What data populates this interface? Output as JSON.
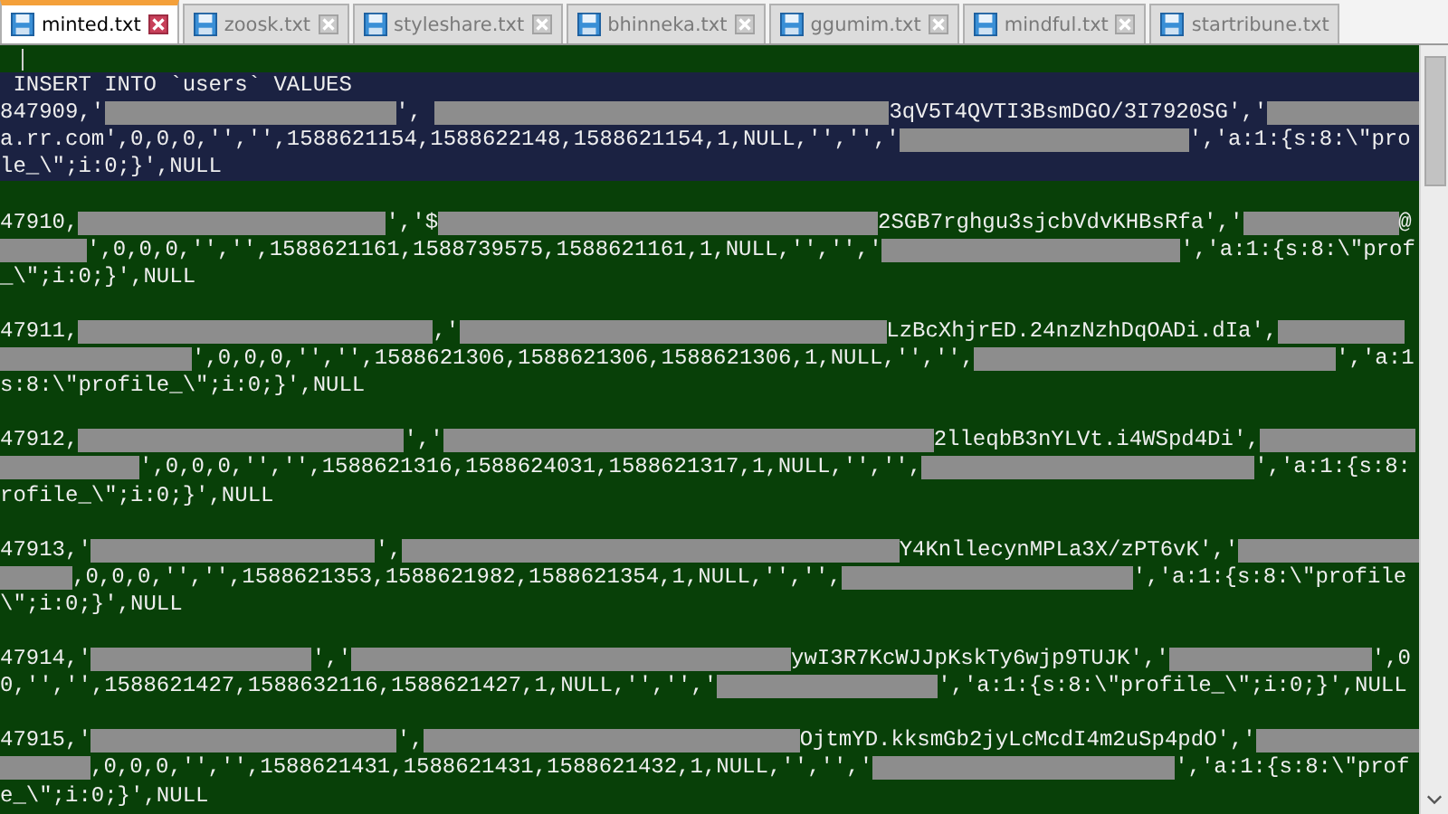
{
  "tabs": [
    {
      "label": "minted.txt",
      "selected": true
    },
    {
      "label": "zoosk.txt",
      "selected": false
    },
    {
      "label": "styleshare.txt",
      "selected": false
    },
    {
      "label": "bhinneka.txt",
      "selected": false
    },
    {
      "label": "ggumim.txt",
      "selected": false
    },
    {
      "label": "mindful.txt",
      "selected": false
    },
    {
      "label": "startribune.txt",
      "selected": false
    }
  ],
  "lines": [
    {
      "selected": false,
      "caret": true
    },
    {
      "selected": true,
      "caret": false,
      "segments": [
        {
          "kind": "text",
          "text": " INSERT INTO `users` VALUES"
        }
      ]
    },
    {
      "selected": true,
      "caret": false,
      "segments": [
        {
          "kind": "text",
          "text": "847909,'"
        },
        {
          "kind": "redacted"
        },
        {
          "kind": "text",
          "text": "', "
        },
        {
          "kind": "redacted"
        },
        {
          "kind": "text",
          "text": "3qV5T4QVTI3BsmDGO/3I7920SG','"
        },
        {
          "kind": "redacted"
        }
      ]
    },
    {
      "selected": true,
      "caret": false,
      "segments": [
        {
          "kind": "text",
          "text": "a.rr.com',0,0,0,'','',1588621154,1588622148,1588621154,1,NULL,'','','"
        },
        {
          "kind": "redacted"
        },
        {
          "kind": "text",
          "text": "','a:1:{s:8:\\\"pro"
        }
      ]
    },
    {
      "selected": true,
      "caret": false,
      "segments": [
        {
          "kind": "text",
          "text": "le_\\\";i:0;}',NULL"
        }
      ]
    },
    {
      "selected": false,
      "caret": false
    },
    {
      "selected": false,
      "caret": false,
      "segments": [
        {
          "kind": "text",
          "text": "47910,"
        },
        {
          "kind": "redacted"
        },
        {
          "kind": "text",
          "text": "','$"
        },
        {
          "kind": "redacted"
        },
        {
          "kind": "text",
          "text": "2SGB7rghgu3sjcbVdvKHBsRfa','"
        },
        {
          "kind": "redacted"
        },
        {
          "kind": "text",
          "text": "@"
        }
      ]
    },
    {
      "selected": false,
      "caret": false,
      "segments": [
        {
          "kind": "redacted"
        },
        {
          "kind": "text",
          "text": "',0,0,0,'','',1588621161,1588739575,1588621161,1,NULL,'','','"
        },
        {
          "kind": "redacted"
        },
        {
          "kind": "text",
          "text": "','a:1:{s:8:\\\"prof"
        }
      ]
    },
    {
      "selected": false,
      "caret": false,
      "segments": [
        {
          "kind": "text",
          "text": "_\\\";i:0;}',NULL"
        }
      ]
    },
    {
      "selected": false,
      "caret": false
    },
    {
      "selected": false,
      "caret": false,
      "segments": [
        {
          "kind": "text",
          "text": "47911,"
        },
        {
          "kind": "redacted"
        },
        {
          "kind": "text",
          "text": ",'"
        },
        {
          "kind": "redacted"
        },
        {
          "kind": "text",
          "text": "LzBcXhjrED.24nzNzhDqOADi.dIa',"
        },
        {
          "kind": "redacted"
        }
      ]
    },
    {
      "selected": false,
      "caret": false,
      "segments": [
        {
          "kind": "redacted"
        },
        {
          "kind": "text",
          "text": "',0,0,0,'','',1588621306,1588621306,1588621306,1,NULL,'','',"
        },
        {
          "kind": "redacted"
        },
        {
          "kind": "text",
          "text": "','a:1"
        }
      ]
    },
    {
      "selected": false,
      "caret": false,
      "segments": [
        {
          "kind": "text",
          "text": "s:8:\\\"profile_\\\";i:0;}',NULL"
        }
      ]
    },
    {
      "selected": false,
      "caret": false
    },
    {
      "selected": false,
      "caret": false,
      "segments": [
        {
          "kind": "text",
          "text": "47912,"
        },
        {
          "kind": "redacted"
        },
        {
          "kind": "text",
          "text": "','"
        },
        {
          "kind": "redacted"
        },
        {
          "kind": "text",
          "text": "2lleqbB3nYLVt.i4WSpd4Di',"
        },
        {
          "kind": "redacted"
        }
      ]
    },
    {
      "selected": false,
      "caret": false,
      "segments": [
        {
          "kind": "redacted"
        },
        {
          "kind": "text",
          "text": "',0,0,0,'','',1588621316,1588624031,1588621317,1,NULL,'','',"
        },
        {
          "kind": "redacted"
        },
        {
          "kind": "text",
          "text": "','a:1:{s:8:"
        }
      ]
    },
    {
      "selected": false,
      "caret": false,
      "segments": [
        {
          "kind": "text",
          "text": "rofile_\\\";i:0;}',NULL"
        }
      ]
    },
    {
      "selected": false,
      "caret": false
    },
    {
      "selected": false,
      "caret": false,
      "segments": [
        {
          "kind": "text",
          "text": "47913,'"
        },
        {
          "kind": "redacted"
        },
        {
          "kind": "text",
          "text": "',"
        },
        {
          "kind": "redacted"
        },
        {
          "kind": "text",
          "text": "Y4KnllecynMPLa3X/zPT6vK','"
        },
        {
          "kind": "redacted"
        }
      ]
    },
    {
      "selected": false,
      "caret": false,
      "segments": [
        {
          "kind": "redacted"
        },
        {
          "kind": "text",
          "text": ",0,0,0,'','',1588621353,1588621982,1588621354,1,NULL,'','',"
        },
        {
          "kind": "redacted"
        },
        {
          "kind": "text",
          "text": "','a:1:{s:8:\\\"profile"
        }
      ]
    },
    {
      "selected": false,
      "caret": false,
      "segments": [
        {
          "kind": "text",
          "text": "\\\";i:0;}',NULL"
        }
      ]
    },
    {
      "selected": false,
      "caret": false
    },
    {
      "selected": false,
      "caret": false,
      "segments": [
        {
          "kind": "text",
          "text": "47914,'"
        },
        {
          "kind": "redacted"
        },
        {
          "kind": "text",
          "text": "','"
        },
        {
          "kind": "redacted"
        },
        {
          "kind": "text",
          "text": "ywI3R7KcWJJpKskTy6wjp9TUJK','"
        },
        {
          "kind": "redacted"
        },
        {
          "kind": "text",
          "text": "',0"
        }
      ]
    },
    {
      "selected": false,
      "caret": false,
      "segments": [
        {
          "kind": "text",
          "text": "0,'','',1588621427,1588632116,1588621427,1,NULL,'','','"
        },
        {
          "kind": "redacted"
        },
        {
          "kind": "text",
          "text": "','a:1:{s:8:\\\"profile_\\\";i:0;}',NULL"
        }
      ]
    },
    {
      "selected": false,
      "caret": false
    },
    {
      "selected": false,
      "caret": false,
      "segments": [
        {
          "kind": "text",
          "text": "47915,'"
        },
        {
          "kind": "redacted"
        },
        {
          "kind": "text",
          "text": "',"
        },
        {
          "kind": "redacted"
        },
        {
          "kind": "text",
          "text": "OjtmYD.kksmGb2jyLcMcdI4m2uSp4pdO','"
        },
        {
          "kind": "redacted"
        }
      ]
    },
    {
      "selected": false,
      "caret": false,
      "segments": [
        {
          "kind": "redacted"
        },
        {
          "kind": "text",
          "text": ",0,0,0,'','',1588621431,1588621431,1588621432,1,NULL,'','','"
        },
        {
          "kind": "redacted"
        },
        {
          "kind": "text",
          "text": "','a:1:{s:8:\\\"prof"
        }
      ]
    },
    {
      "selected": false,
      "caret": false,
      "segments": [
        {
          "kind": "text",
          "text": "e_\\\";i:0;}',NULL"
        }
      ]
    }
  ]
}
